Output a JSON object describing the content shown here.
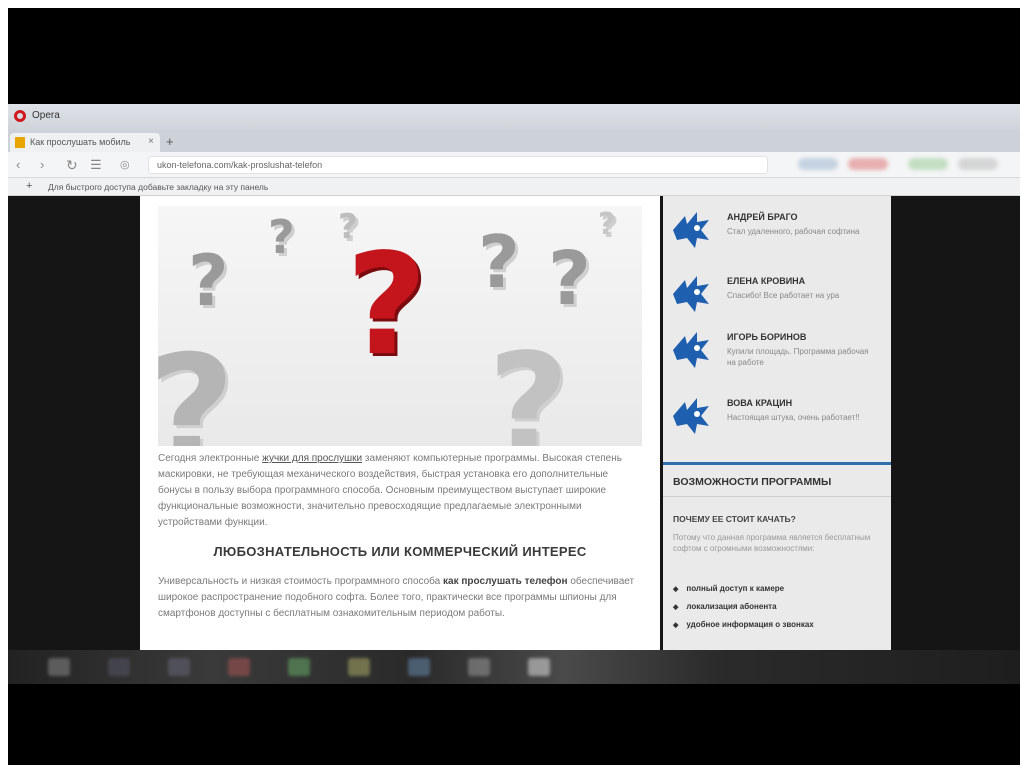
{
  "browser": {
    "window_title": "Opera",
    "tab_label": "Как прослушать мобиль",
    "tab_close": "×",
    "new_tab": "+",
    "url": "ukon-telefona.com/kak-proslushat-telefon",
    "bookmark_plus": "+",
    "bookmark_hint": "Для быстрого доступа добавьте закладку на эту панель"
  },
  "article": {
    "intro": "Сегодня электронные жучки для прослушки заменяют компьютерные программы. Высокая степень маскировки, не требующая механического воздействия, быстрая установка его дополнительные бонусы в пользу выбора программного способа. Основным преимуществом выступает широкие функциональные возможности, значительно превосходящие предлагаемые электронными устройствами функции.",
    "intro_link": "жучки для прослушки",
    "heading": "ЛЮБОЗНАТЕЛЬНОСТЬ ИЛИ КОММЕРЧЕСКИЙ ИНТЕРЕС",
    "para2_start": "Универсальность и низкая стоимость программного способа ",
    "para2_bold": "как прослушать телефон",
    "para2_end": " обеспечивает широкое распространение подобного софта. Более того, практически все программы шпионы для смартфонов доступны с бесплатным ознакомительным периодом работы."
  },
  "sidebar": {
    "users": [
      {
        "name": "АНДРЕЙ БРАГО",
        "text": "Стал удаленного, рабочая софтина"
      },
      {
        "name": "ЕЛЕНА КРОВИНА",
        "text": "Спасибо! Все работает на ура"
      },
      {
        "name": "ИГОРЬ БОРИНОВ",
        "text": "Купили площадь. Программа рабочая на работе"
      },
      {
        "name": "ВОВА КРАЦИН",
        "text": "Настоящая штука, очень работает!!"
      }
    ],
    "features_title": "ВОЗМОЖНОСТИ ПРОГРАММЫ",
    "why_title": "ПОЧЕМУ ЕЕ СТОИТ КАЧАТЬ?",
    "why_text": "Потому что данная программа является бесплатным софтом с огромными возможностями:",
    "bullets": [
      "полный доступ к камере",
      "локализация абонента",
      "удобное информация о звонках"
    ]
  },
  "colors": {
    "accent_blue": "#2f6fad",
    "question_red": "#c4151c",
    "avatar_blue": "#1f5fb0"
  }
}
